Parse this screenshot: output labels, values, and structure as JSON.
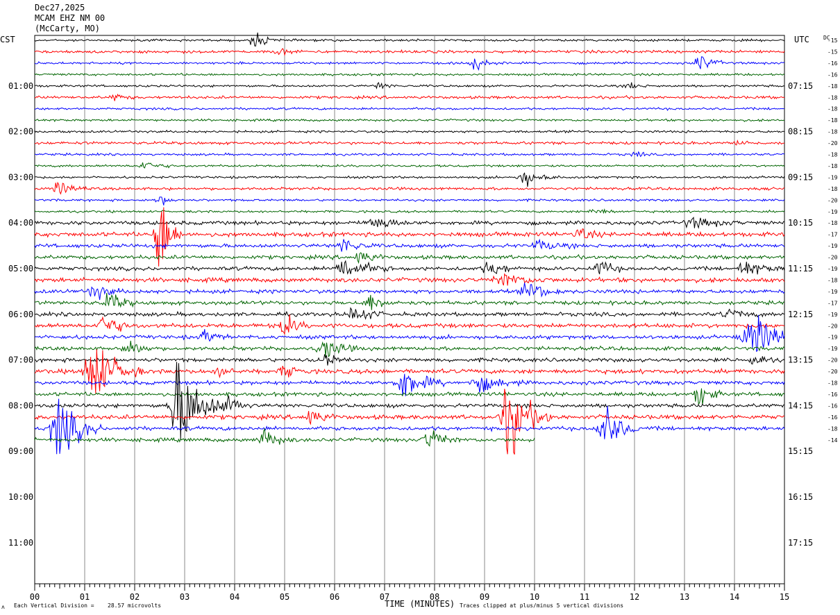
{
  "header": {
    "date": "Dec27,2025",
    "station": "MCAM EHZ NM 00",
    "location": "(McCarty, MO)"
  },
  "left_zone_label": "CST",
  "right_zone_label": "UTC",
  "dc_label": "DC",
  "footer": {
    "division_label": "Each Vertical Division =",
    "division_value": "28.57 microvolts",
    "xlabel": "TIME (MINUTES)",
    "clip_note": "Traces clipped at plus/minus 5 vertical divisions",
    "corner_mark": "ʌ"
  },
  "chart_data": {
    "type": "line",
    "title": "",
    "xlabel": "TIME (MINUTES)",
    "xlim": [
      0,
      15
    ],
    "x_tick_labels": [
      "00",
      "01",
      "02",
      "03",
      "04",
      "05",
      "06",
      "07",
      "08",
      "09",
      "10",
      "11",
      "12",
      "13",
      "14",
      "15"
    ],
    "cst_hour_labels": [
      "01:00",
      "02:00",
      "03:00",
      "04:00",
      "05:00",
      "06:00",
      "07:00",
      "08:00",
      "09:00",
      "10:00",
      "11:00"
    ],
    "utc_hour_labels": [
      "07:15",
      "08:15",
      "09:15",
      "10:15",
      "11:15",
      "12:15",
      "13:15",
      "14:15",
      "15:15",
      "16:15",
      "17:15"
    ],
    "trace_colors": [
      "#000000",
      "#ff0000",
      "#0000ff",
      "#006400"
    ],
    "dc_offsets": [
      -15,
      -15,
      -16,
      -16,
      -18,
      -18,
      -18,
      -18,
      -18,
      -20,
      -18,
      -18,
      -19,
      -18,
      -20,
      -19,
      -18,
      -17,
      -19,
      -20,
      -19,
      -18,
      -19,
      -17,
      -19,
      -20,
      -19,
      -19,
      -20,
      -20,
      -18,
      -16,
      -16,
      -16,
      -18,
      -14
    ],
    "events": [
      {
        "trace": 0,
        "minute": 4.4,
        "amp": 9,
        "width": 0.45
      },
      {
        "trace": 1,
        "minute": 4.9,
        "amp": 4,
        "width": 0.4
      },
      {
        "trace": 2,
        "minute": 8.8,
        "amp": 8,
        "width": 0.5
      },
      {
        "trace": 2,
        "minute": 13.3,
        "amp": 10,
        "width": 0.5
      },
      {
        "trace": 4,
        "minute": 6.9,
        "amp": 5,
        "width": 0.3
      },
      {
        "trace": 4,
        "minute": 11.9,
        "amp": 5,
        "width": 0.3
      },
      {
        "trace": 5,
        "minute": 1.6,
        "amp": 4,
        "width": 0.4
      },
      {
        "trace": 9,
        "minute": 14.1,
        "amp": 5,
        "width": 0.3
      },
      {
        "trace": 10,
        "minute": 12.0,
        "amp": 8,
        "width": 0.2
      },
      {
        "trace": 11,
        "minute": 2.2,
        "amp": 6,
        "width": 0.5
      },
      {
        "trace": 12,
        "minute": 9.8,
        "amp": 10,
        "width": 0.6
      },
      {
        "trace": 13,
        "minute": 0.5,
        "amp": 8,
        "width": 0.5
      },
      {
        "trace": 14,
        "minute": 2.5,
        "amp": 8,
        "width": 0.3
      },
      {
        "trace": 15,
        "minute": 11.2,
        "amp": 5,
        "width": 0.4
      },
      {
        "trace": 16,
        "minute": 6.8,
        "amp": 10,
        "width": 0.6
      },
      {
        "trace": 16,
        "minute": 13.2,
        "amp": 6,
        "width": 0.8
      },
      {
        "trace": 17,
        "minute": 2.5,
        "amp": 60,
        "width": 0.4
      },
      {
        "trace": 17,
        "minute": 10.9,
        "amp": 8,
        "width": 0.4
      },
      {
        "trace": 18,
        "minute": 6.2,
        "amp": 10,
        "width": 0.5
      },
      {
        "trace": 18,
        "minute": 10.1,
        "amp": 6,
        "width": 0.6
      },
      {
        "trace": 19,
        "minute": 6.5,
        "amp": 8,
        "width": 0.5
      },
      {
        "trace": 20,
        "minute": 6.2,
        "amp": 14,
        "width": 0.8
      },
      {
        "trace": 20,
        "minute": 9.1,
        "amp": 10,
        "width": 0.5
      },
      {
        "trace": 20,
        "minute": 11.3,
        "amp": 12,
        "width": 0.4
      },
      {
        "trace": 20,
        "minute": 14.2,
        "amp": 8,
        "width": 0.8
      },
      {
        "trace": 21,
        "minute": 9.4,
        "amp": 8,
        "width": 0.8
      },
      {
        "trace": 22,
        "minute": 1.2,
        "amp": 10,
        "width": 0.5
      },
      {
        "trace": 22,
        "minute": 9.9,
        "amp": 12,
        "width": 0.6
      },
      {
        "trace": 23,
        "minute": 1.5,
        "amp": 12,
        "width": 0.5
      },
      {
        "trace": 23,
        "minute": 6.7,
        "amp": 10,
        "width": 0.5
      },
      {
        "trace": 24,
        "minute": 6.4,
        "amp": 12,
        "width": 0.5
      },
      {
        "trace": 24,
        "minute": 13.9,
        "amp": 6,
        "width": 0.6
      },
      {
        "trace": 25,
        "minute": 1.4,
        "amp": 16,
        "width": 0.5
      },
      {
        "trace": 25,
        "minute": 5.0,
        "amp": 16,
        "width": 0.4
      },
      {
        "trace": 26,
        "minute": 3.4,
        "amp": 8,
        "width": 0.4
      },
      {
        "trace": 26,
        "minute": 14.4,
        "amp": 24,
        "width": 1.0
      },
      {
        "trace": 27,
        "minute": 1.9,
        "amp": 14,
        "width": 0.4
      },
      {
        "trace": 27,
        "minute": 5.8,
        "amp": 12,
        "width": 0.6
      },
      {
        "trace": 28,
        "minute": 5.8,
        "amp": 12,
        "width": 0.4
      },
      {
        "trace": 28,
        "minute": 14.4,
        "amp": 8,
        "width": 0.4
      },
      {
        "trace": 29,
        "minute": 1.2,
        "amp": 40,
        "width": 0.8
      },
      {
        "trace": 29,
        "minute": 3.7,
        "amp": 10,
        "width": 0.3
      },
      {
        "trace": 29,
        "minute": 5.0,
        "amp": 8,
        "width": 0.4
      },
      {
        "trace": 30,
        "minute": 7.4,
        "amp": 20,
        "width": 0.7
      },
      {
        "trace": 30,
        "minute": 8.9,
        "amp": 10,
        "width": 0.8
      },
      {
        "trace": 31,
        "minute": 13.3,
        "amp": 16,
        "width": 0.4
      },
      {
        "trace": 32,
        "minute": 2.9,
        "amp": 60,
        "width": 0.8
      },
      {
        "trace": 32,
        "minute": 3.9,
        "amp": 14,
        "width": 0.4
      },
      {
        "trace": 33,
        "minute": 9.5,
        "amp": 50,
        "width": 0.7
      },
      {
        "trace": 33,
        "minute": 5.5,
        "amp": 10,
        "width": 0.5
      },
      {
        "trace": 34,
        "minute": 0.5,
        "amp": 40,
        "width": 0.7
      },
      {
        "trace": 34,
        "minute": 11.4,
        "amp": 30,
        "width": 0.6
      },
      {
        "trace": 35,
        "minute": 4.6,
        "amp": 12,
        "width": 0.5
      },
      {
        "trace": 35,
        "minute": 7.9,
        "amp": 14,
        "width": 0.5
      }
    ],
    "data_end_minute": 10.0
  }
}
